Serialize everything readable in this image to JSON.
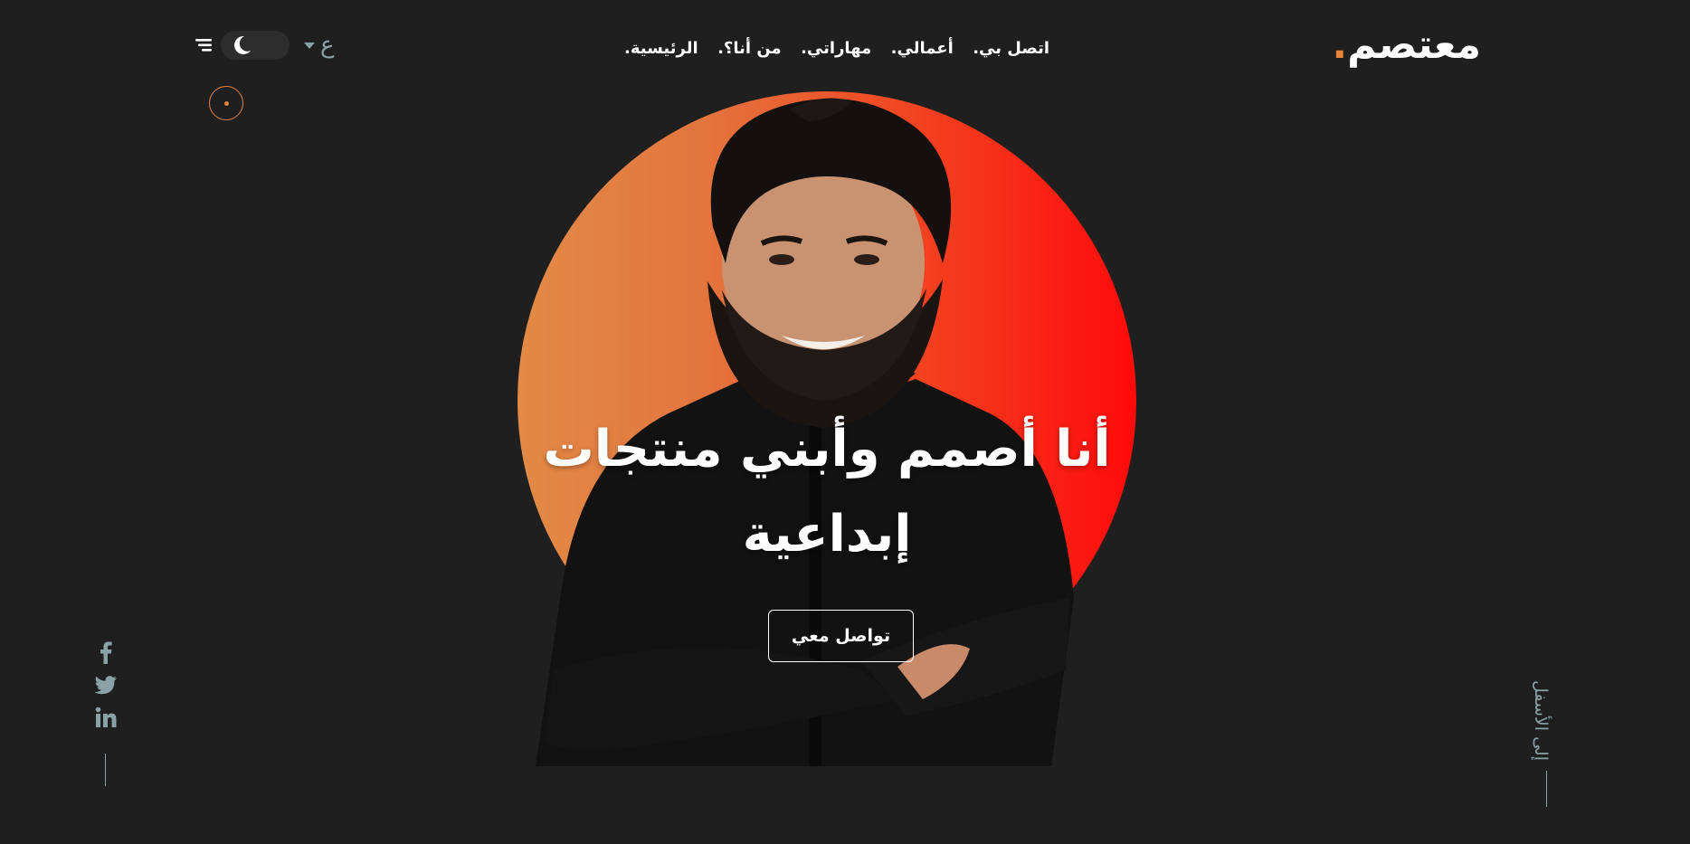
{
  "brand": {
    "name": "معتصم",
    "dot": ".",
    "accent_color": "#e8833a"
  },
  "nav": {
    "items": [
      {
        "label": "الرئيسية."
      },
      {
        "label": "من أنا؟."
      },
      {
        "label": "مهاراتي."
      },
      {
        "label": "أعمالي."
      },
      {
        "label": "اتصل بي."
      }
    ]
  },
  "controls": {
    "menu_icon": "menu-lines-icon",
    "theme_icon": "moon-icon",
    "language_label": "ع",
    "language_caret_icon": "caret-down-icon"
  },
  "hero": {
    "title": "أنا أصمم وأبني منتجات إبداعية",
    "cta_label": "تواصل معي",
    "circle_gradient": [
      "#e28a46",
      "#ff0a0a"
    ]
  },
  "socials": [
    {
      "icon": "facebook-icon"
    },
    {
      "icon": "twitter-icon"
    },
    {
      "icon": "linkedin-icon"
    }
  ],
  "scroll_down": {
    "label": "إلى الأسفل"
  },
  "colors": {
    "background": "#1f1f1f",
    "muted": "#8aa1a6",
    "text": "#ffffff"
  }
}
